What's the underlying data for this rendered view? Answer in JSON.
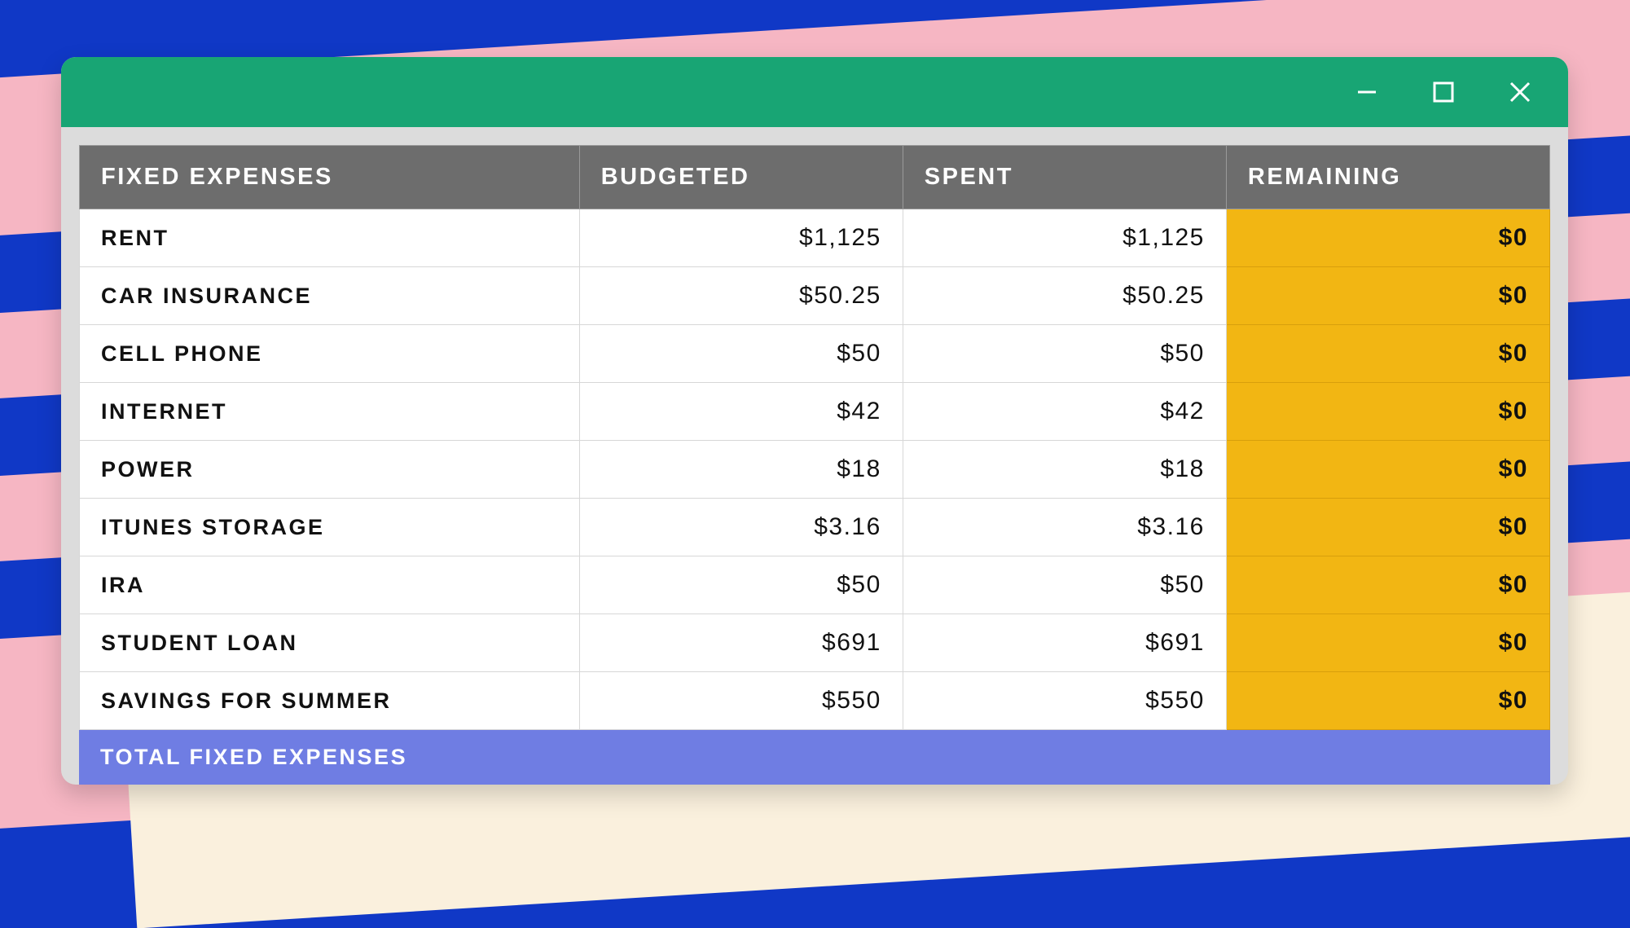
{
  "window_controls": {
    "minimize": "minimize",
    "maximize": "maximize",
    "close": "close"
  },
  "table": {
    "headers": {
      "col1": "FIXED EXPENSES",
      "col2": "BUDGETED",
      "col3": "SPENT",
      "col4": "REMAINING"
    },
    "rows": [
      {
        "label": "RENT",
        "budgeted": "$1,125",
        "spent": "$1,125",
        "remaining": "$0"
      },
      {
        "label": "CAR INSURANCE",
        "budgeted": "$50.25",
        "spent": "$50.25",
        "remaining": "$0"
      },
      {
        "label": "CELL PHONE",
        "budgeted": "$50",
        "spent": "$50",
        "remaining": "$0"
      },
      {
        "label": "INTERNET",
        "budgeted": "$42",
        "spent": "$42",
        "remaining": "$0"
      },
      {
        "label": "POWER",
        "budgeted": "$18",
        "spent": "$18",
        "remaining": "$0"
      },
      {
        "label": "ITUNES STORAGE",
        "budgeted": "$3.16",
        "spent": "$3.16",
        "remaining": "$0"
      },
      {
        "label": "IRA",
        "budgeted": "$50",
        "spent": "$50",
        "remaining": "$0"
      },
      {
        "label": "STUDENT LOAN",
        "budgeted": "$691",
        "spent": "$691",
        "remaining": "$0"
      },
      {
        "label": "SAVINGS FOR SUMMER",
        "budgeted": "$550",
        "spent": "$550",
        "remaining": "$0"
      }
    ],
    "total_label": "TOTAL FIXED EXPENSES"
  }
}
